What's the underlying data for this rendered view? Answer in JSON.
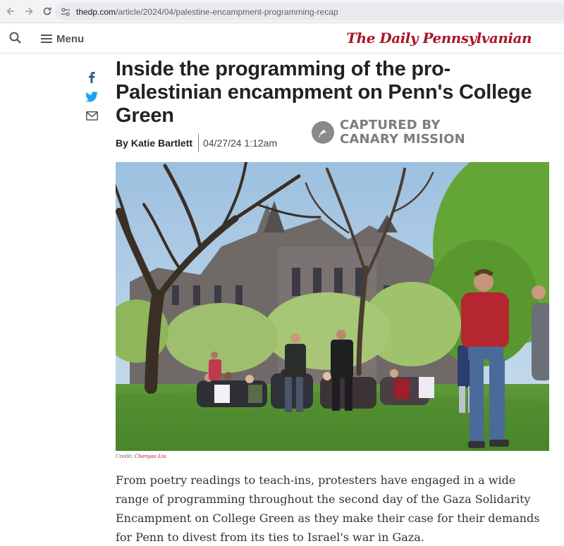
{
  "browser": {
    "url_domain": "thedp.com",
    "url_path": "/article/2024/04/palestine-encampment-programming-recap"
  },
  "header": {
    "menu_label": "Menu",
    "masthead": "The Daily Pennsylvanian"
  },
  "share": {
    "icons": [
      "facebook-icon",
      "twitter-icon",
      "email-icon"
    ]
  },
  "article": {
    "headline": "Inside the programming of the pro-Palestinian encampment on Penn's College Green",
    "by_prefix": "By",
    "author": "Katie Bartlett",
    "date": "04/27/24 1:12am",
    "watermark_line1": "CAPTURED BY",
    "watermark_line2": "CANARY MISSION",
    "credit_label": "Credit:",
    "credit_name": "Chenyao Liu",
    "body": "From poetry readings to teach-ins, protesters have engaged in a wide range of programming throughout the second day of the Gaza Solidarity Encampment on College Green as they make their case for their demands for Penn to divest from its ties to Israel's war in Gaza."
  },
  "colors": {
    "brand_red": "#a8172b",
    "facebook_blue": "#3b5998",
    "twitter_blue": "#1da1f2"
  }
}
